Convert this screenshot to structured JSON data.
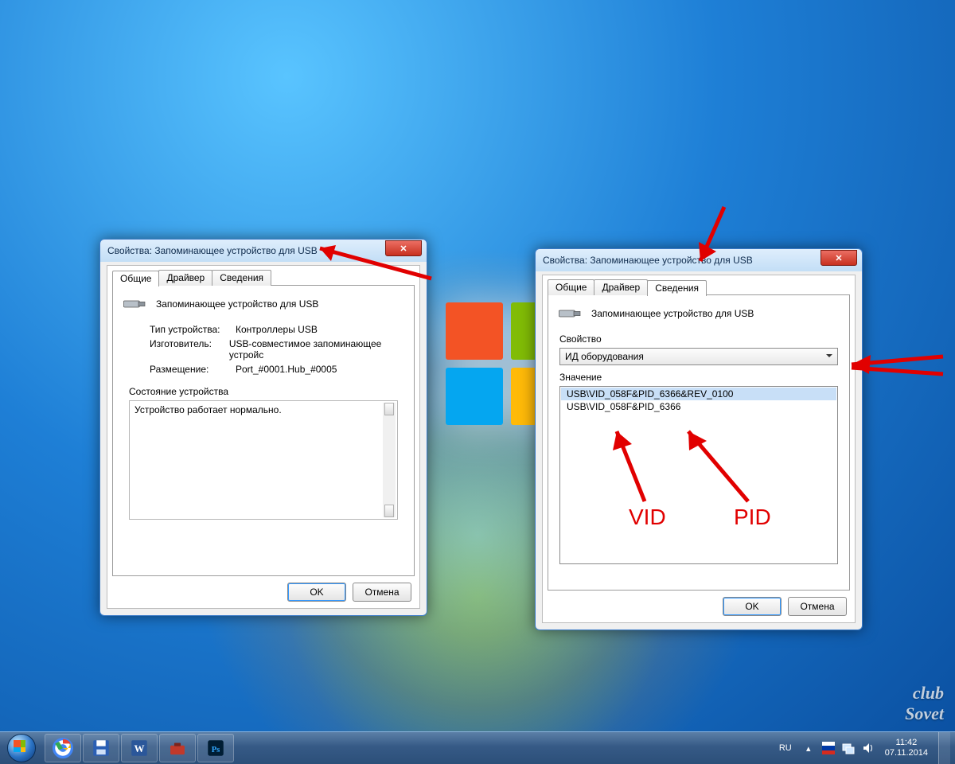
{
  "dialog1": {
    "title": "Свойства: Запоминающее устройство для USB",
    "tabs": [
      "Общие",
      "Драйвер",
      "Сведения"
    ],
    "active_tab": 0,
    "device_name": "Запоминающее устройство для USB",
    "fields": {
      "type_label": "Тип устройства:",
      "type_value": "Контроллеры USB",
      "mfr_label": "Изготовитель:",
      "mfr_value": "USB-совместимое запоминающее устройс",
      "loc_label": "Размещение:",
      "loc_value": "Port_#0001.Hub_#0005"
    },
    "status_label": "Состояние устройства",
    "status_text": "Устройство работает нормально.",
    "ok": "OK",
    "cancel": "Отмена"
  },
  "dialog2": {
    "title": "Свойства: Запоминающее устройство для USB",
    "tabs": [
      "Общие",
      "Драйвер",
      "Сведения"
    ],
    "active_tab": 2,
    "device_name": "Запоминающее устройство для USB",
    "property_label": "Свойство",
    "property_value": "ИД оборудования",
    "value_label": "Значение",
    "values": [
      "USB\\VID_058F&PID_6366&REV_0100",
      "USB\\VID_058F&PID_6366"
    ],
    "ok": "OK",
    "cancel": "Отмена"
  },
  "annotations": {
    "vid_label": "VID",
    "pid_label": "PID"
  },
  "taskbar": {
    "lang": "RU",
    "time": "11:42",
    "date": "07.11.2014"
  },
  "watermark": "club\nSovet"
}
